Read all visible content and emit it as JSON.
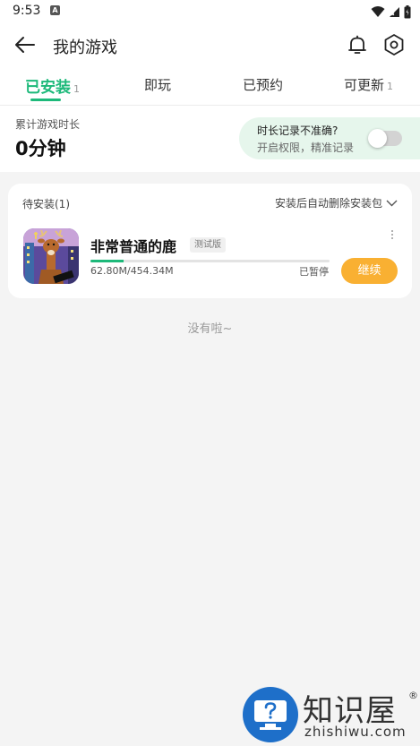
{
  "status_bar": {
    "time": "9:53",
    "notification_icon": "A",
    "icons": [
      "wifi-icon",
      "signal-icon",
      "battery-icon"
    ]
  },
  "header": {
    "title": "我的游戏",
    "icons": [
      "back-arrow-icon",
      "bell-icon",
      "settings-hex-icon"
    ]
  },
  "tabs": [
    {
      "label": "已安装",
      "count": "1",
      "active": true
    },
    {
      "label": "即玩",
      "count": "",
      "active": false
    },
    {
      "label": "已预约",
      "count": "",
      "active": false
    },
    {
      "label": "可更新",
      "count": "1",
      "active": false
    }
  ],
  "play_time": {
    "label": "累计游戏时长",
    "value": "0分钟",
    "banner_title": "时长记录不准确?",
    "banner_subtitle": "开启权限，精准记录",
    "toggle_on": false
  },
  "install_section": {
    "pending_label": "待安装(1)",
    "auto_delete_label": "安装后自动删除安装包",
    "game": {
      "name": "非常普通的鹿",
      "badge": "测试版",
      "downloaded": "62.80M",
      "total": "454.34M",
      "size_text": "62.80M/454.34M",
      "progress": 0.138,
      "status": "已暂停",
      "action_label": "继续"
    }
  },
  "empty_text": "没有啦~",
  "watermark": {
    "title": "知识屋",
    "registered": "®",
    "url": "zhishiwu.com"
  },
  "colors": {
    "accent_green": "#1db97a",
    "continue_orange": "#f9b032",
    "banner_bg": "#e6f6ec",
    "page_bg": "#f4f4f4"
  }
}
